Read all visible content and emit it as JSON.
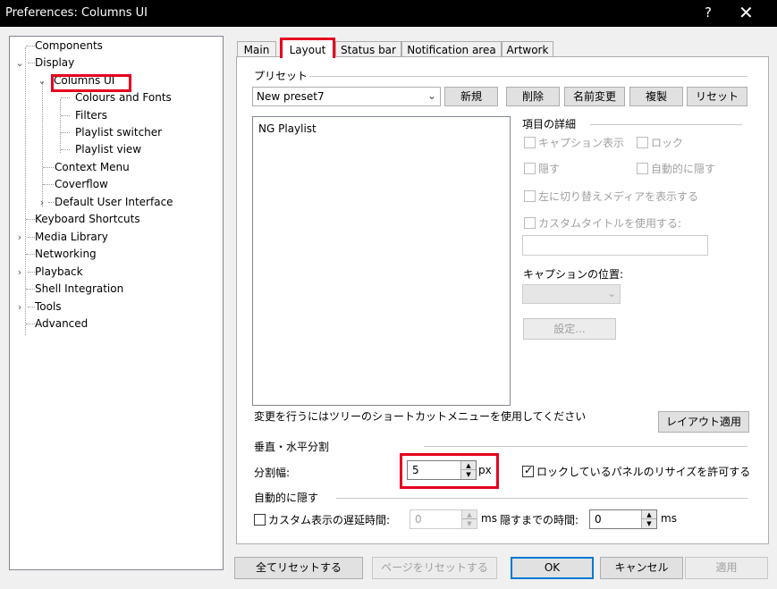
{
  "window": {
    "title": "Preferences: Columns UI",
    "help_label": "?",
    "close_label": "✕"
  },
  "tree": {
    "items": [
      {
        "label": "Components"
      },
      {
        "label": "Display"
      },
      {
        "label": "Columns UI"
      },
      {
        "label": "Colours and Fonts"
      },
      {
        "label": "Filters"
      },
      {
        "label": "Playlist switcher"
      },
      {
        "label": "Playlist view"
      },
      {
        "label": "Context Menu"
      },
      {
        "label": "Coverflow"
      },
      {
        "label": "Default User Interface"
      },
      {
        "label": "Keyboard Shortcuts"
      },
      {
        "label": "Media Library"
      },
      {
        "label": "Networking"
      },
      {
        "label": "Playback"
      },
      {
        "label": "Shell Integration"
      },
      {
        "label": "Tools"
      },
      {
        "label": "Advanced"
      }
    ],
    "selected": "Columns UI"
  },
  "tabs": [
    {
      "label": "Main"
    },
    {
      "label": "Layout"
    },
    {
      "label": "Status bar"
    },
    {
      "label": "Notification area"
    },
    {
      "label": "Artwork"
    }
  ],
  "layout": {
    "preset_group": "プリセット",
    "preset_value": "New preset7",
    "buttons": {
      "new": "新規",
      "delete": "削除",
      "rename": "名前変更",
      "copy": "複製",
      "reset": "リセット"
    },
    "list_items": [
      "NG Playlist"
    ],
    "details": {
      "group": "項目の詳細",
      "show_caption": "キャプション表示",
      "lock": "ロック",
      "hide": "隠す",
      "auto_hide": "自動的に隠す",
      "show_toggle_left": "左に切り替えメディアを表示する",
      "use_custom_title": "カスタムタイトルを使用する:",
      "caption_position": "キャプションの位置:",
      "settings_button": "設定..."
    },
    "hint": "変更を行うにはツリーのショートカットメニューを使用してください",
    "apply_layout": "レイアウト適用",
    "splitter_group": "垂直・水平分割",
    "splitter_width_label": "分割幅:",
    "splitter_width_value": "5",
    "px_unit": "px",
    "allow_resize_locked": "ロックしているパネルのリサイズを許可する",
    "autohide_group": "自動的に隠す",
    "custom_delay_label": "カスタム表示の遅延時間:",
    "custom_delay_value": "0",
    "ms_unit": "ms",
    "hide_time_label": "隠すまでの時間:",
    "hide_time_value": "0",
    "ms_unit_2": "ms"
  },
  "bottom": {
    "reset_all": "全てリセットする",
    "reset_page": "ページをリセットする",
    "ok": "OK",
    "cancel": "キャンセル",
    "apply": "適用"
  }
}
